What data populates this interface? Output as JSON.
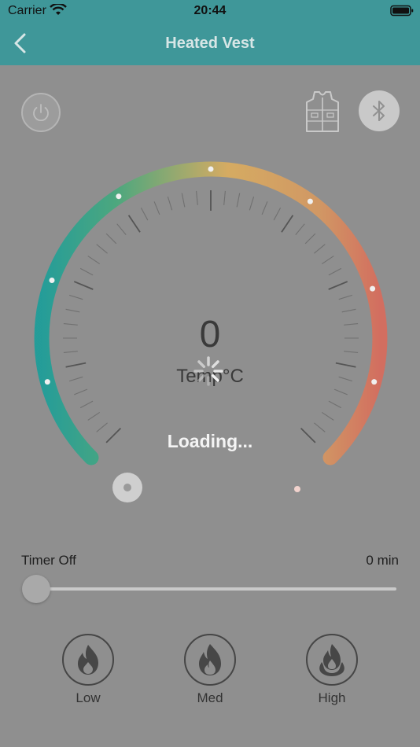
{
  "status": {
    "carrier": "Carrier",
    "time": "20:44",
    "icons": [
      "wifi-icon",
      "battery-icon"
    ]
  },
  "nav": {
    "title": "Heated Vest",
    "back_icon": "chevron-left-icon"
  },
  "controls": {
    "power_icon": "power-icon",
    "vest_icon": "vest-icon",
    "bluetooth_icon": "bluetooth-icon"
  },
  "dial": {
    "value": "0",
    "label": "Temp°C",
    "gradient_colors": [
      "#0aa09b",
      "#3cad7a",
      "#e7b257",
      "#e36654"
    ]
  },
  "overlay": {
    "loading_text": "Loading...",
    "spinner_icon": "spinner-icon"
  },
  "timer": {
    "label": "Timer Off",
    "value": "0 min",
    "level": 0
  },
  "modes": [
    {
      "label": "Low",
      "icon": "flame-low-icon"
    },
    {
      "label": "Med",
      "icon": "flame-med-icon"
    },
    {
      "label": "High",
      "icon": "flame-high-icon"
    }
  ],
  "colors": {
    "header": "#3f9799",
    "overlay_bg": "#8f8f8f"
  }
}
